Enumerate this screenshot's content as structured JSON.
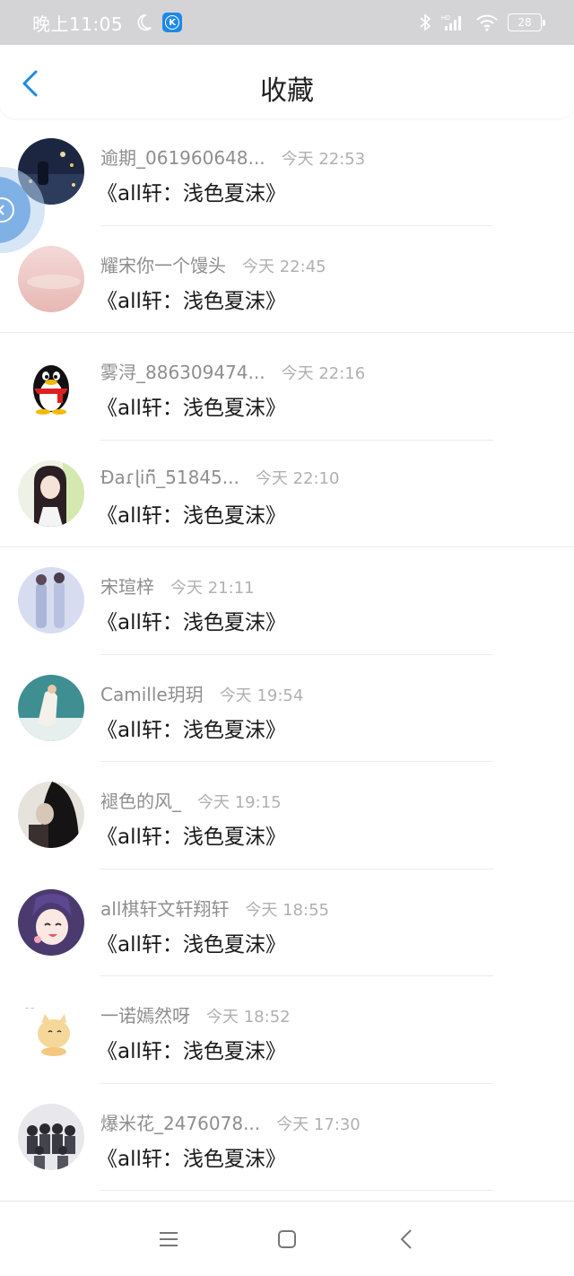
{
  "status_bar": {
    "time": "晚上11:05",
    "battery": "28",
    "icons": [
      "moon-icon",
      "app-k-icon",
      "bluetooth-icon",
      "hd-signal-icon",
      "wifi-icon",
      "battery-icon"
    ]
  },
  "header": {
    "title": "收藏",
    "back_icon": "chevron-left-icon"
  },
  "favorites": [
    {
      "name": "逾期_061960648...",
      "time": "今天 22:53",
      "title": "《all轩：浅色夏沫》"
    },
    {
      "name": "耀宋你一个馒头",
      "time": "今天 22:45",
      "title": "《all轩：浅色夏沫》"
    },
    {
      "name": "雾浔_886309474...",
      "time": "今天 22:16",
      "title": "《all轩：浅色夏沫》"
    },
    {
      "name": "Ɖaɾɭiñ̃_51845...",
      "time": "今天 22:10",
      "title": "《all轩：浅色夏沫》"
    },
    {
      "name": "宋瑄梓",
      "time": "今天 21:11",
      "title": "《all轩：浅色夏沫》"
    },
    {
      "name": "Camille玥玥",
      "time": "今天 19:54",
      "title": "《all轩：浅色夏沫》"
    },
    {
      "name": "褪色的风_",
      "time": "今天 19:15",
      "title": "《all轩：浅色夏沫》"
    },
    {
      "name": "all棋轩文轩翔轩",
      "time": "今天 18:55",
      "title": "《all轩：浅色夏沫》"
    },
    {
      "name": "一诺嫣然呀",
      "time": "今天 18:52",
      "title": "《all轩：浅色夏沫》"
    },
    {
      "name": "爆米花_2476078...",
      "time": "今天 17:30",
      "title": "《all轩：浅色夏沫》"
    }
  ],
  "nav_bar": {
    "icons": [
      "menu-icon",
      "home-square-icon",
      "back-triangle-icon"
    ]
  },
  "colors": {
    "status_bar_bg": "#d4d4d6",
    "accent": "#1e88e5",
    "name_text": "#8e8e8e",
    "time_text": "#b0b0b0"
  }
}
